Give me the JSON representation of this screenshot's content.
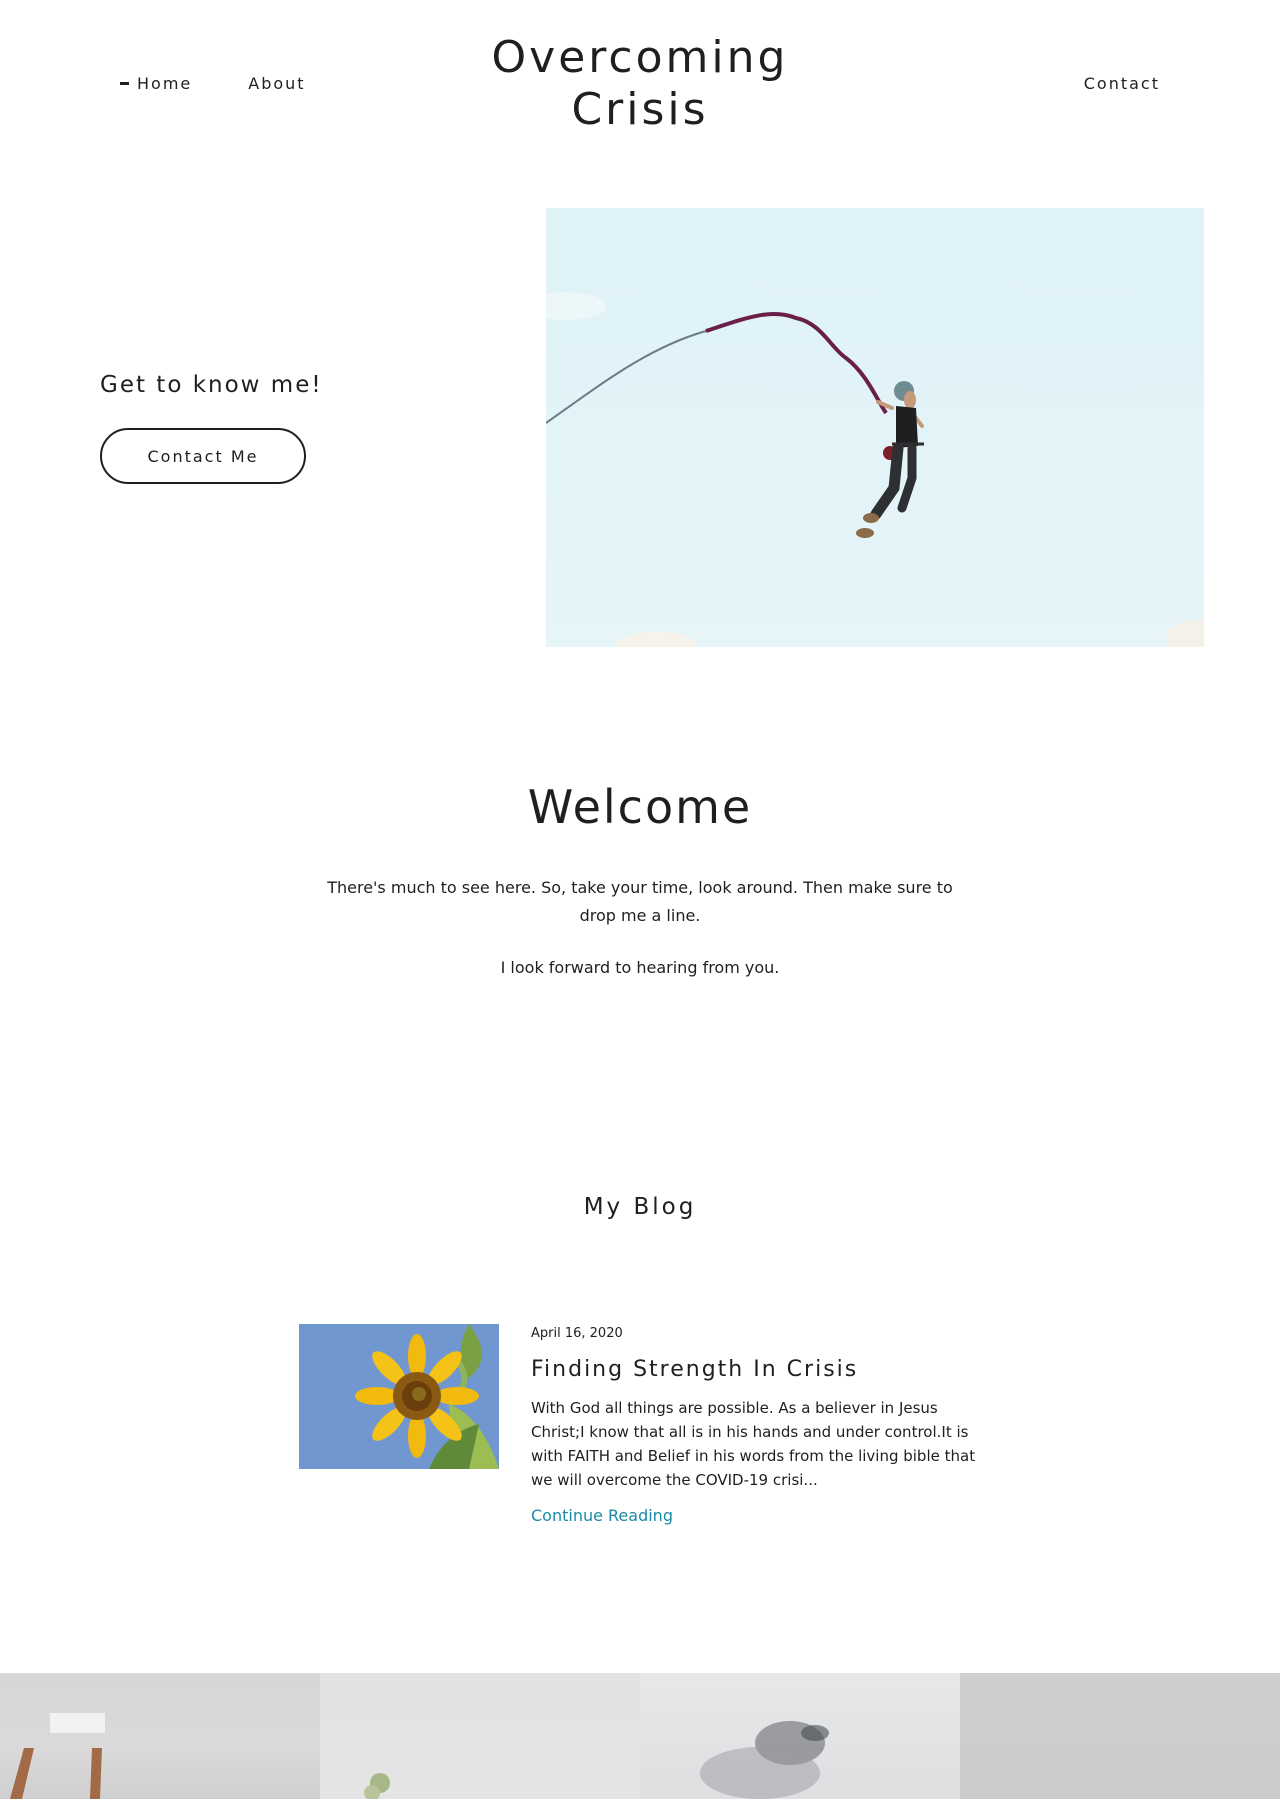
{
  "header": {
    "site_title_line1": "Overcoming",
    "site_title_line2": "Crisis",
    "nav": {
      "home": "Home",
      "about": "About",
      "contact": "Contact"
    }
  },
  "hero": {
    "tagline": "Get to know me!",
    "button_label": "Contact Me",
    "image_icon": "bungee-jumper-photo"
  },
  "welcome": {
    "title": "Welcome",
    "body": "There's much to see here. So, take your time, look around. Then make sure to drop me a line.",
    "closing": "I look forward to hearing from you."
  },
  "blog": {
    "heading": "My Blog",
    "posts": [
      {
        "date": "April 16, 2020",
        "title": "Finding Strength In Crisis",
        "excerpt": "With God all things are possible. As a believer in Jesus Christ;I know that all is in his hands and under control.It is with FAITH and Belief in his words from the living bible that we will overcome the COVID-19 crisi...",
        "link_label": "Continue Reading",
        "thumbnail_icon": "sunflower-photo"
      }
    ]
  },
  "colors": {
    "text": "#1f1f1f",
    "link": "#1a8ba6",
    "sky": "#e0f2f7",
    "thumb_sky": "#6f95cf"
  }
}
